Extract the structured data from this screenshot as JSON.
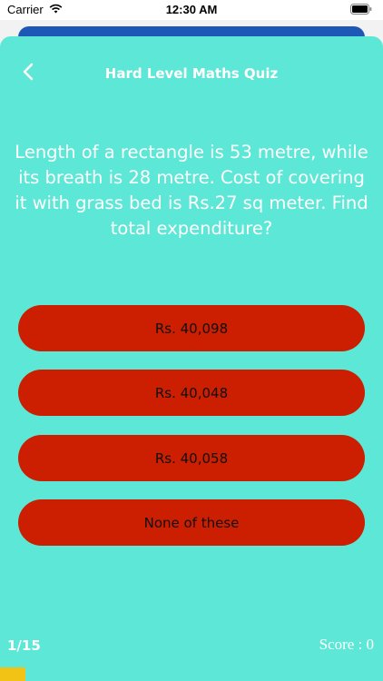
{
  "status_bar": {
    "carrier": "Carrier",
    "time": "12:30 AM",
    "icons": [
      "wifi-icon",
      "battery-icon"
    ]
  },
  "quiz": {
    "title": "Hard Level Maths Quiz",
    "question": "Length of a rectangle is 53 metre, while its breath is 28 metre. Cost of covering it with grass bed is Rs.27 sq meter. Find total expenditure?",
    "options": [
      "Rs. 40,098",
      "Rs. 40,048",
      "Rs. 40,058",
      "None of these"
    ],
    "progress_text": "1/15",
    "score_text": "Score : 0",
    "progress_fraction": 0.0667
  },
  "colors": {
    "background": "#5de7d6",
    "option_button": "#cc1e00",
    "progress_fill": "#f2c214",
    "behind_sheet": "#1e58b6"
  }
}
